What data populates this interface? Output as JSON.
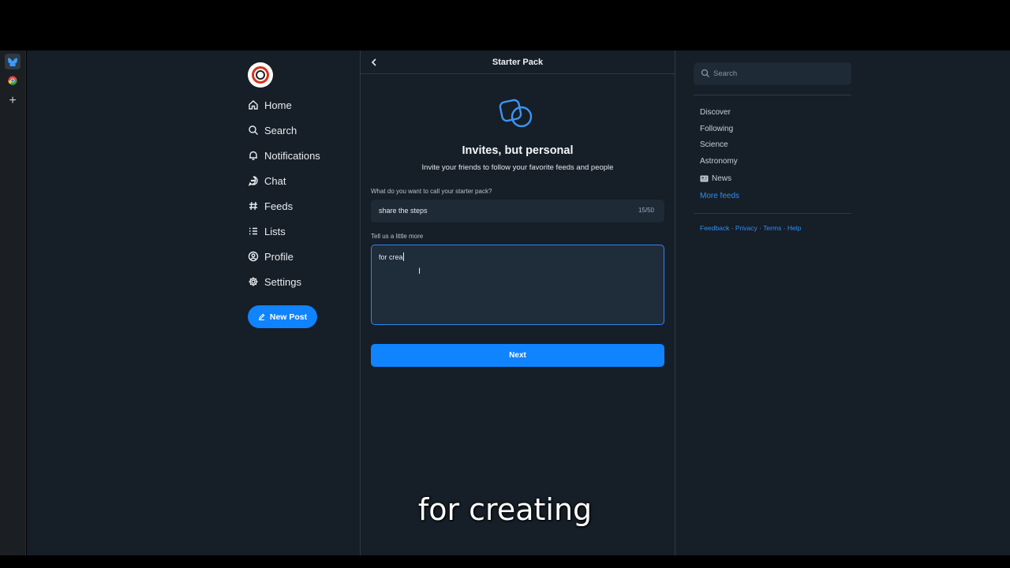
{
  "app": {
    "header_title": "Starter Pack"
  },
  "nav": {
    "items": [
      {
        "label": "Home",
        "icon": "home-icon"
      },
      {
        "label": "Search",
        "icon": "search-icon"
      },
      {
        "label": "Notifications",
        "icon": "bell-icon"
      },
      {
        "label": "Chat",
        "icon": "chat-icon"
      },
      {
        "label": "Feeds",
        "icon": "hash-icon"
      },
      {
        "label": "Lists",
        "icon": "list-icon"
      },
      {
        "label": "Profile",
        "icon": "profile-icon"
      },
      {
        "label": "Settings",
        "icon": "gear-icon"
      }
    ],
    "new_post_label": "New Post"
  },
  "main": {
    "title": "Invites, but personal",
    "subtitle": "Invite your friends to follow your favorite feeds and people",
    "name_label": "What do you want to call your starter pack?",
    "name_value": "share the steps",
    "name_count": "15/50",
    "desc_label": "Tell us a little more",
    "desc_value": "for crea",
    "next_label": "Next"
  },
  "sidebar": {
    "search_placeholder": "Search",
    "feeds": [
      "Discover",
      "Following",
      "Science",
      "Astronomy",
      "News"
    ],
    "more_feeds": "More feeds",
    "footer": [
      "Feedback",
      "Privacy",
      "Terms",
      "Help"
    ],
    "footer_sep": " · "
  },
  "caption": "for creating",
  "colors": {
    "accent": "#1083fe",
    "background": "#161e27",
    "link": "#2f8ff5"
  }
}
